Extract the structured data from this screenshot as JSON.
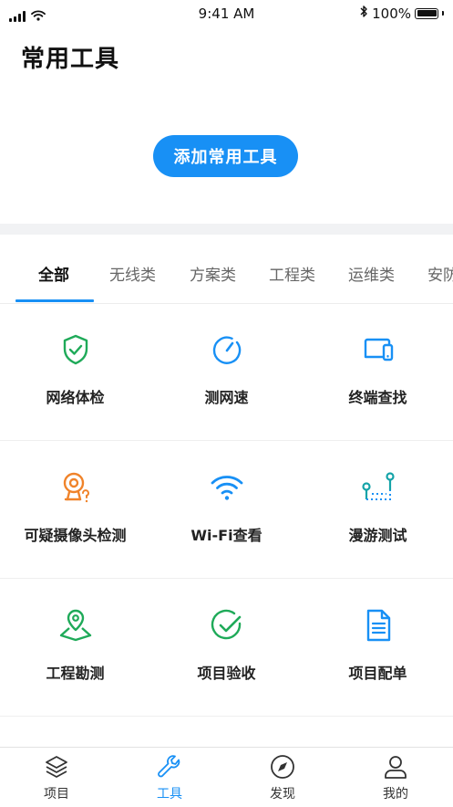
{
  "status_bar": {
    "time": "9:41 AM",
    "battery": "100%"
  },
  "header": {
    "title": "常用工具",
    "add_button": "添加常用工具"
  },
  "tabs": [
    "全部",
    "无线类",
    "方案类",
    "工程类",
    "运维类",
    "安防"
  ],
  "active_tab": "全部",
  "tools": [
    {
      "label": "网络体检",
      "icon": "shield-check-icon"
    },
    {
      "label": "测网速",
      "icon": "speedometer-icon"
    },
    {
      "label": "终端查找",
      "icon": "devices-icon"
    },
    {
      "label": "可疑摄像头检测",
      "icon": "camera-question-icon"
    },
    {
      "label": "Wi-Fi查看",
      "icon": "wifi-icon"
    },
    {
      "label": "漫游测试",
      "icon": "roaming-icon"
    },
    {
      "label": "工程勘测",
      "icon": "map-pin-icon"
    },
    {
      "label": "项目验收",
      "icon": "check-circle-icon"
    },
    {
      "label": "项目配单",
      "icon": "document-icon"
    }
  ],
  "bottom_nav": [
    {
      "label": "项目",
      "icon": "layers-icon"
    },
    {
      "label": "工具",
      "icon": "wrench-icon"
    },
    {
      "label": "发现",
      "icon": "compass-icon"
    },
    {
      "label": "我的",
      "icon": "user-icon"
    }
  ],
  "active_nav": "工具",
  "colors": {
    "accent": "#1890f5",
    "green": "#1faa59",
    "orange": "#f0832a",
    "teal": "#14a3a8"
  }
}
